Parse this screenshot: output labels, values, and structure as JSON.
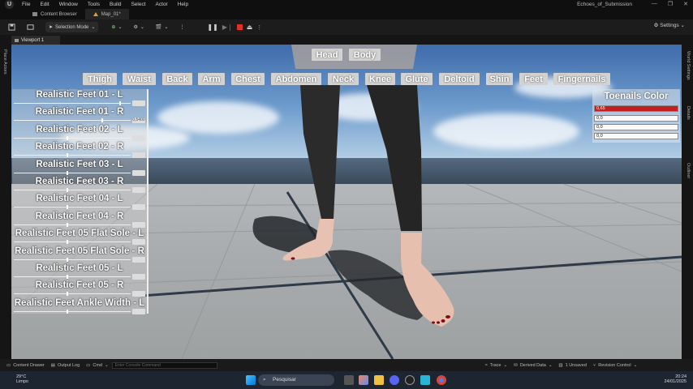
{
  "menubar": {
    "logo_text": "U",
    "items": [
      "File",
      "Edit",
      "Window",
      "Tools",
      "Build",
      "Select",
      "Actor",
      "Help"
    ],
    "project_name": "Echoes_of_Submission",
    "window_controls": [
      "—",
      "❐",
      "✕"
    ]
  },
  "tabs": [
    {
      "label": "Content Browser",
      "icon": "content-browser-icon"
    },
    {
      "label": "Map_01*",
      "icon": "level-icon"
    }
  ],
  "toolbar": {
    "save_icon": "save-icon",
    "selection_mode": "Selection Mode",
    "settings": "Settings",
    "colors": {
      "stop": "#e0302a"
    }
  },
  "left_strip": {
    "place_actors": "Place Actors"
  },
  "right_strip": {
    "world_settings": "World Settings",
    "details": "Details",
    "outliner": "Outliner"
  },
  "viewport": {
    "tab_label": "Viewport 1",
    "top_buttons": [
      "Head",
      "Body"
    ],
    "category_buttons": [
      "Thigh",
      "Waist",
      "Back",
      "Arm",
      "Chest",
      "Abdomen",
      "Neck",
      "Knee",
      "Glute",
      "Deltoid",
      "Shin",
      "Feet",
      "Fingernails"
    ],
    "sliders": [
      {
        "label": "Realistic Feet 01 - L",
        "value": 0.9,
        "box": ""
      },
      {
        "label": "Realistic Feet 01 - R",
        "value": 0.75,
        "box": "0,5400"
      },
      {
        "label": "Realistic Feet 02 - L",
        "value": 0.45,
        "box": ""
      },
      {
        "label": "Realistic Feet 02 - R",
        "value": 0.45,
        "box": ""
      },
      {
        "label": "Realistic Feet 03 - L",
        "value": 0.45,
        "box": ""
      },
      {
        "label": "Realistic Feet 03 - R",
        "value": 0.45,
        "box": ""
      },
      {
        "label": "Realistic Feet 04 - L",
        "value": 0.45,
        "box": ""
      },
      {
        "label": "Realistic Feet 04 - R",
        "value": 0.45,
        "box": ""
      },
      {
        "label": "Realistic Feet 05 Flat Sole - L",
        "value": 0.45,
        "box": ""
      },
      {
        "label": "Realistic Feet 05 Flat Sole - R",
        "value": 0.45,
        "box": ""
      },
      {
        "label": "Realistic Feet 05 - L",
        "value": 0.45,
        "box": ""
      },
      {
        "label": "Realistic Feet 05 - R",
        "value": 0.45,
        "box": ""
      },
      {
        "label": "Realistic Feet Ankle Width - L",
        "value": 0.45,
        "box": ""
      }
    ],
    "color_panel": {
      "title": "Toenails Color",
      "fields": [
        "0,65",
        "0,0",
        "0,0",
        "0,0"
      ],
      "colors": {
        "red_field": "#c41e1e"
      }
    }
  },
  "bottombar": {
    "content_drawer": "Content Drawer",
    "output_log": "Output Log",
    "cmd": "Cmd",
    "console_placeholder": "Enter Console Command",
    "trace": "Trace",
    "derived_data": "Derived Data",
    "unsaved": "1 Unsaved",
    "revision_control": "Revision Control"
  },
  "taskbar": {
    "temperature": "29°C",
    "weather": "Limpo",
    "search": "Pesquisar",
    "time": "20:24",
    "date": "24/01/2025"
  }
}
